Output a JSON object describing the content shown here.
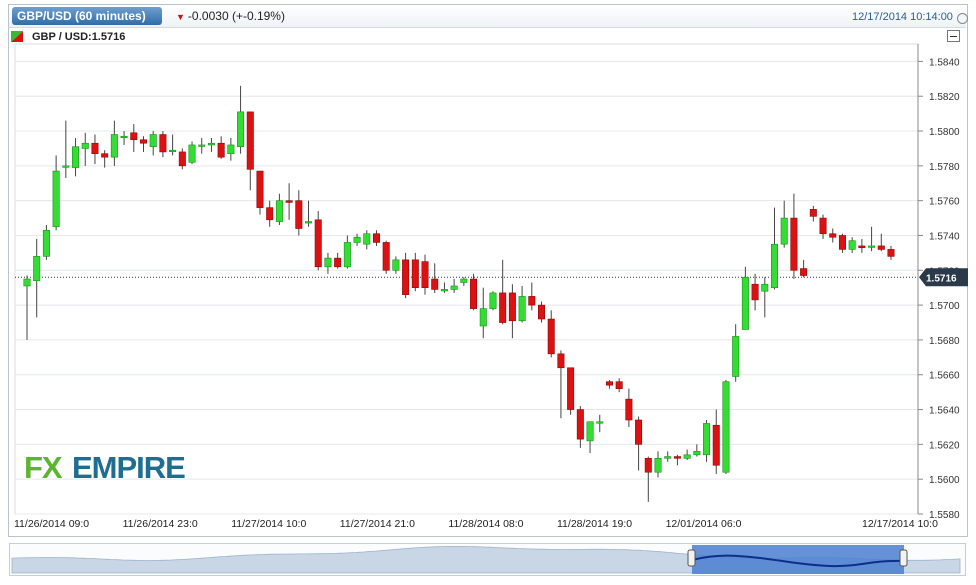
{
  "header": {
    "tab_label": "GBP/USD (60 minutes)",
    "change_text": "-0.0030 (+-0.19%)",
    "datetime": "12/17/2014 10:14:00",
    "change_icon": "down-triangle-icon"
  },
  "subheader": {
    "label": "GBP / USD:1.5716"
  },
  "watermark": {
    "fx": "FX",
    "empire": "EMPIRE"
  },
  "colors": {
    "up": "#33dd33",
    "down": "#dd1111",
    "price_tag": "#2b3a4a",
    "logo_green": "#5cb531",
    "logo_blue": "#1f6d90"
  },
  "chart_data": {
    "type": "candlestick",
    "title": "GBP / USD:1.5716",
    "ylim": [
      1.558,
      1.585
    ],
    "yticks": [
      "1.5840",
      "1.5820",
      "1.5800",
      "1.5780",
      "1.5760",
      "1.5740",
      "1.5720",
      "1.5700",
      "1.5680",
      "1.5660",
      "1.5640",
      "1.5620",
      "1.5600",
      "1.5580"
    ],
    "xtick_labels": [
      "11/26/2014 09:0",
      "11/26/2014 23:0",
      "11/27/2014 10:0",
      "11/27/2014 21:0",
      "11/28/2014 08:0",
      "11/28/2014 19:0",
      "12/01/2014 06:0",
      "12/17/2014 10:0"
    ],
    "last_price": 1.5716,
    "last_price_label": "1.5716",
    "candles": [
      [
        1.5711,
        1.5715,
        1.5717,
        1.568
      ],
      [
        1.5714,
        1.5728,
        1.5738,
        1.5693
      ],
      [
        1.5728,
        1.5743,
        1.5746,
        1.5726
      ],
      [
        1.5745,
        1.5777,
        1.5786,
        1.5743
      ],
      [
        1.578,
        1.578,
        1.5806,
        1.5773
      ],
      [
        1.5779,
        1.5791,
        1.5796,
        1.5774
      ],
      [
        1.579,
        1.5793,
        1.5799,
        1.578
      ],
      [
        1.5793,
        1.5787,
        1.5798,
        1.5781
      ],
      [
        1.5787,
        1.5785,
        1.5789,
        1.5779
      ],
      [
        1.5785,
        1.5798,
        1.5806,
        1.578
      ],
      [
        1.5797,
        1.5797,
        1.58,
        1.5792
      ],
      [
        1.5799,
        1.5795,
        1.5804,
        1.5788
      ],
      [
        1.5795,
        1.5793,
        1.5797,
        1.5788
      ],
      [
        1.5791,
        1.5798,
        1.58,
        1.5786
      ],
      [
        1.5798,
        1.5788,
        1.58,
        1.5785
      ],
      [
        1.5789,
        1.5789,
        1.5798,
        1.5786
      ],
      [
        1.5788,
        1.578,
        1.579,
        1.5778
      ],
      [
        1.5782,
        1.5792,
        1.5794,
        1.5781
      ],
      [
        1.5792,
        1.5792,
        1.5796,
        1.5787
      ],
      [
        1.5792,
        1.5793,
        1.5796,
        1.5788
      ],
      [
        1.5793,
        1.5785,
        1.5797,
        1.5784
      ],
      [
        1.5787,
        1.5792,
        1.5796,
        1.5783
      ],
      [
        1.5791,
        1.5811,
        1.5826,
        1.5787
      ],
      [
        1.5811,
        1.5778,
        1.5811,
        1.5766
      ],
      [
        1.5777,
        1.5756,
        1.5777,
        1.5752
      ],
      [
        1.5756,
        1.5749,
        1.576,
        1.5745
      ],
      [
        1.5748,
        1.576,
        1.5764,
        1.5746
      ],
      [
        1.576,
        1.5759,
        1.577,
        1.5749
      ],
      [
        1.576,
        1.5744,
        1.5766,
        1.574
      ],
      [
        1.5748,
        1.5748,
        1.576,
        1.5745
      ],
      [
        1.5749,
        1.5722,
        1.5754,
        1.572
      ],
      [
        1.5722,
        1.5727,
        1.573,
        1.5718
      ],
      [
        1.5727,
        1.5722,
        1.573,
        1.5721
      ],
      [
        1.5722,
        1.5736,
        1.574,
        1.5721
      ],
      [
        1.5736,
        1.5739,
        1.5741,
        1.5734
      ],
      [
        1.5735,
        1.5741,
        1.5743,
        1.5732
      ],
      [
        1.5741,
        1.5736,
        1.5743,
        1.5734
      ],
      [
        1.5736,
        1.572,
        1.5737,
        1.5718
      ],
      [
        1.572,
        1.5726,
        1.5728,
        1.5718
      ],
      [
        1.5726,
        1.5706,
        1.573,
        1.5704
      ],
      [
        1.5726,
        1.571,
        1.573,
        1.5708
      ],
      [
        1.5725,
        1.571,
        1.5729,
        1.5706
      ],
      [
        1.5715,
        1.5709,
        1.5724,
        1.5707
      ],
      [
        1.5709,
        1.5709,
        1.5713,
        1.5707
      ],
      [
        1.5709,
        1.5711,
        1.5715,
        1.5707
      ],
      [
        1.5713,
        1.5715,
        1.5716,
        1.5711
      ],
      [
        1.5715,
        1.5698,
        1.5718,
        1.5697
      ],
      [
        1.5688,
        1.5698,
        1.571,
        1.5681
      ],
      [
        1.5698,
        1.5707,
        1.5708,
        1.5697
      ],
      [
        1.5707,
        1.569,
        1.5726,
        1.5689
      ],
      [
        1.5707,
        1.5691,
        1.5712,
        1.5681
      ],
      [
        1.5691,
        1.5705,
        1.5711,
        1.569
      ],
      [
        1.5705,
        1.57,
        1.5713,
        1.5697
      ],
      [
        1.57,
        1.5692,
        1.5702,
        1.569
      ],
      [
        1.5692,
        1.5672,
        1.5697,
        1.567
      ],
      [
        1.5672,
        1.5664,
        1.5674,
        1.5635
      ],
      [
        1.5664,
        1.564,
        1.5664,
        1.5637
      ],
      [
        1.564,
        1.5623,
        1.5642,
        1.5618
      ],
      [
        1.5622,
        1.5633,
        1.5633,
        1.5615
      ],
      [
        1.5633,
        1.5633,
        1.5637,
        1.5627
      ],
      [
        1.5656,
        1.5654,
        1.5657,
        1.5652
      ],
      [
        1.5656,
        1.5652,
        1.5658,
        1.565
      ],
      [
        1.5646,
        1.5634,
        1.5652,
        1.563
      ],
      [
        1.5634,
        1.562,
        1.5636,
        1.5605
      ],
      [
        1.5612,
        1.5604,
        1.5613,
        1.5587
      ],
      [
        1.5604,
        1.5612,
        1.5616,
        1.5601
      ],
      [
        1.5612,
        1.5613,
        1.5616,
        1.561
      ],
      [
        1.5613,
        1.5612,
        1.5614,
        1.5608
      ],
      [
        1.5612,
        1.5614,
        1.5617,
        1.5611
      ],
      [
        1.5614,
        1.5616,
        1.562,
        1.5613
      ],
      [
        1.5614,
        1.5632,
        1.5634,
        1.561
      ],
      [
        1.5631,
        1.5608,
        1.564,
        1.5603
      ],
      [
        1.5604,
        1.5656,
        1.5657,
        1.5603
      ],
      [
        1.5659,
        1.5682,
        1.5689,
        1.5656
      ],
      [
        1.5686,
        1.5716,
        1.5722,
        1.5686
      ],
      [
        1.5712,
        1.5703,
        1.5718,
        1.5697
      ],
      [
        1.5708,
        1.5712,
        1.5716,
        1.5693
      ],
      [
        1.571,
        1.5735,
        1.5756,
        1.5709
      ],
      [
        1.5735,
        1.575,
        1.576,
        1.5733
      ],
      [
        1.575,
        1.572,
        1.5764,
        1.5715
      ],
      [
        1.5721,
        1.5717,
        1.5726,
        1.5716
      ],
      [
        1.5755,
        1.5751,
        1.5757,
        1.5748
      ],
      [
        1.575,
        1.5741,
        1.5752,
        1.5738
      ],
      [
        1.5741,
        1.5739,
        1.5744,
        1.5736
      ],
      [
        1.574,
        1.5732,
        1.5741,
        1.573
      ],
      [
        1.5732,
        1.5737,
        1.5739,
        1.573
      ],
      [
        1.5734,
        1.5733,
        1.5738,
        1.573
      ],
      [
        1.5734,
        1.5734,
        1.5745,
        1.5731
      ],
      [
        1.5734,
        1.5732,
        1.5741,
        1.5731
      ],
      [
        1.5732,
        1.5728,
        1.5734,
        1.5726
      ]
    ]
  }
}
